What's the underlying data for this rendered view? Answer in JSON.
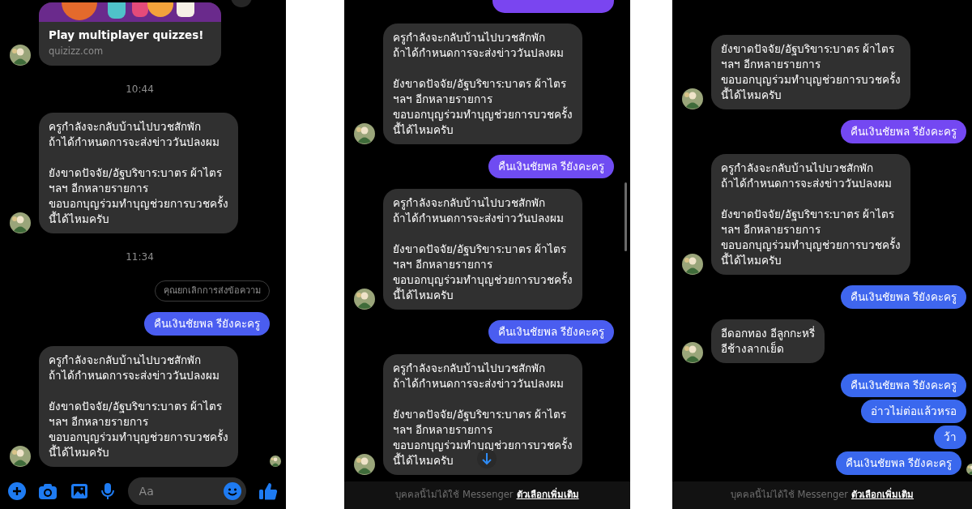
{
  "panels": [
    {
      "footer": {
        "kind": "composer",
        "placeholder": "Aa"
      },
      "messages": [
        {
          "kind": "link",
          "title": "Play multiplayer quizzes!",
          "domain": "quizizz.com",
          "avatar": true
        },
        {
          "kind": "time",
          "text": "10:44"
        },
        {
          "kind": "incoming",
          "text": "ครูกำลังจะกลับบ้านไปบวชสักพัก\nถ้าได้กำหนดการจะส่งข่าววันปลงผม\n\nยังขาดปัจจัย/อัฐบริขาร:บาตร ผ้าไตร\nฯลฯ อีกหลายรายการ\nขอบอกบุญร่วมทำบุญช่วยการบวชครั้ง\nนี้ได้ไหมครับ",
          "avatar": true
        },
        {
          "kind": "time",
          "text": "11:34"
        },
        {
          "kind": "notice",
          "text": "คุณยกเลิกการส่งข้อความ"
        },
        {
          "kind": "outgoing",
          "text": "คืนเงินชัยพล รียังคะครู",
          "color": "#4a5df0"
        },
        {
          "kind": "incoming",
          "text": "ครูกำลังจะกลับบ้านไปบวชสักพัก\nถ้าได้กำหนดการจะส่งข่าววันปลงผม\n\nยังขาดปัจจัย/อัฐบริขาร:บาตร ผ้าไตร\nฯลฯ อีกหลายรายการ\nขอบอกบุญร่วมทำบุญช่วยการบวชครั้ง\nนี้ได้ไหมครับ",
          "avatar": true,
          "seen": true
        }
      ]
    },
    {
      "footer": {
        "kind": "notice",
        "text": "บุคคลนี้ไม่ได้ใช้ Messenger",
        "link": "ตัวเลือกเพิ่มเติม"
      },
      "jump_button": true,
      "messages": [
        {
          "kind": "outgoing",
          "color": "#7a45f0"
        },
        {
          "kind": "incoming",
          "text": "ครูกำลังจะกลับบ้านไปบวชสักพัก\nถ้าได้กำหนดการจะส่งข่าววันปลงผม\n\nยังขาดปัจจัย/อัฐบริขาร:บาตร ผ้าไตร\nฯลฯ อีกหลายรายการ\nขอบอกบุญร่วมทำบุญช่วยการบวชครั้ง\nนี้ได้ไหมครับ",
          "avatar": true
        },
        {
          "kind": "outgoing",
          "text": "คืนเงินชัยพล รียังคะครู",
          "color": "#6f4cf2"
        },
        {
          "kind": "incoming",
          "text": "ครูกำลังจะกลับบ้านไปบวชสักพัก\nถ้าได้กำหนดการจะส่งข่าววันปลงผม\n\nยังขาดปัจจัย/อัฐบริขาร:บาตร ผ้าไตร\nฯลฯ อีกหลายรายการ\nขอบอกบุญร่วมทำบุญช่วยการบวชครั้ง\nนี้ได้ไหมครับ",
          "avatar": true
        },
        {
          "kind": "outgoing",
          "text": "คืนเงินชัยพล รียังคะครู",
          "color": "#4a5df0"
        },
        {
          "kind": "incoming",
          "text": "ครูกำลังจะกลับบ้านไปบวชสักพัก\nถ้าได้กำหนดการจะส่งข่าววันปลงผม\n\nยังขาดปัจจัย/อัฐบริขาร:บาตร ผ้าไตร\nฯลฯ อีกหลายรายการ\nขอบอกบุญร่วมทำบุญช่วยการบวชครั้ง\nนี้ได้ไหมครับ",
          "avatar": true
        }
      ]
    },
    {
      "footer": {
        "kind": "notice",
        "text": "บุคคลนี้ไม่ได้ใช้ Messenger",
        "link": "ตัวเลือกเพิ่มเติม"
      },
      "messages": [
        {
          "kind": "incoming",
          "text": "ยังขาดปัจจัย/อัฐบริขาร:บาตร ผ้าไตร\nฯลฯ อีกหลายรายการ\nขอบอกบุญร่วมทำบุญช่วยการบวชครั้ง\nนี้ได้ไหมครับ",
          "avatar": true
        },
        {
          "kind": "outgoing",
          "text": "คืนเงินชัยพล รียังคะครู",
          "color": "#7448f2"
        },
        {
          "kind": "incoming",
          "text": "ครูกำลังจะกลับบ้านไปบวชสักพัก\nถ้าได้กำหนดการจะส่งข่าววันปลงผม\n\nยังขาดปัจจัย/อัฐบริขาร:บาตร ผ้าไตร\nฯลฯ อีกหลายรายการ\nขอบอกบุญร่วมทำบุญช่วยการบวชครั้ง\nนี้ได้ไหมครับ",
          "avatar": true
        },
        {
          "kind": "outgoing",
          "text": "คืนเงินชัยพล รียังคะครู",
          "color": "#3f66ee"
        },
        {
          "kind": "incoming",
          "text": "อีดอกทอง อีลูกกะหรี่\nอีช้างลากเย็ด",
          "avatar": true
        },
        {
          "kind": "outgoing",
          "text": "คืนเงินชัยพล รียังคะครู",
          "color": "#3a68ee"
        },
        {
          "kind": "outgoing",
          "text": "อ่าวไม่ต่อแล้วหรอ",
          "color": "#3a68ee"
        },
        {
          "kind": "outgoing",
          "text": "ว้า",
          "color": "#3a68ee"
        },
        {
          "kind": "outgoing",
          "text": "คืนเงินชัยพล รียังคะครู",
          "color": "#3a68ee",
          "seen": true
        }
      ]
    }
  ]
}
